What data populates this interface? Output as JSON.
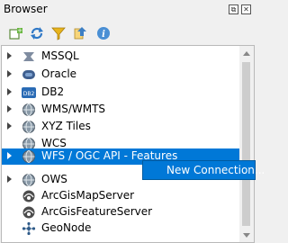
{
  "window": {
    "title": "Browser"
  },
  "title_buttons": {
    "float": "⧉",
    "close": "✕"
  },
  "toolbar": {
    "icons": [
      "add-selected-layers-icon",
      "refresh-icon",
      "filter-icon",
      "collapse-all-icon",
      "info-icon"
    ]
  },
  "tree": {
    "items": [
      {
        "label": "MSSQL",
        "icon": "mssql-icon"
      },
      {
        "label": "Oracle",
        "icon": "oracle-icon"
      },
      {
        "label": "DB2",
        "icon": "db2-icon"
      },
      {
        "label": "WMS/WMTS",
        "icon": "globe-icon"
      },
      {
        "label": "XYZ Tiles",
        "icon": "globe-icon"
      },
      {
        "label": "WCS",
        "icon": "globe-icon"
      },
      {
        "label": "WFS / OGC API - Features",
        "icon": "globe-icon",
        "selected": true
      },
      {
        "label": "OWS",
        "icon": "globe-icon"
      },
      {
        "label": "ArcGisMapServer",
        "icon": "arcgis-icon"
      },
      {
        "label": "ArcGisFeatureServer",
        "icon": "arcgis-icon"
      },
      {
        "label": "GeoNode",
        "icon": "geonode-icon"
      }
    ]
  },
  "context_menu": {
    "items": [
      "New Connection..."
    ]
  },
  "colors": {
    "selection": "#0078d7",
    "panel_bg": "#ffffff",
    "window_bg": "#f0f0f0"
  }
}
